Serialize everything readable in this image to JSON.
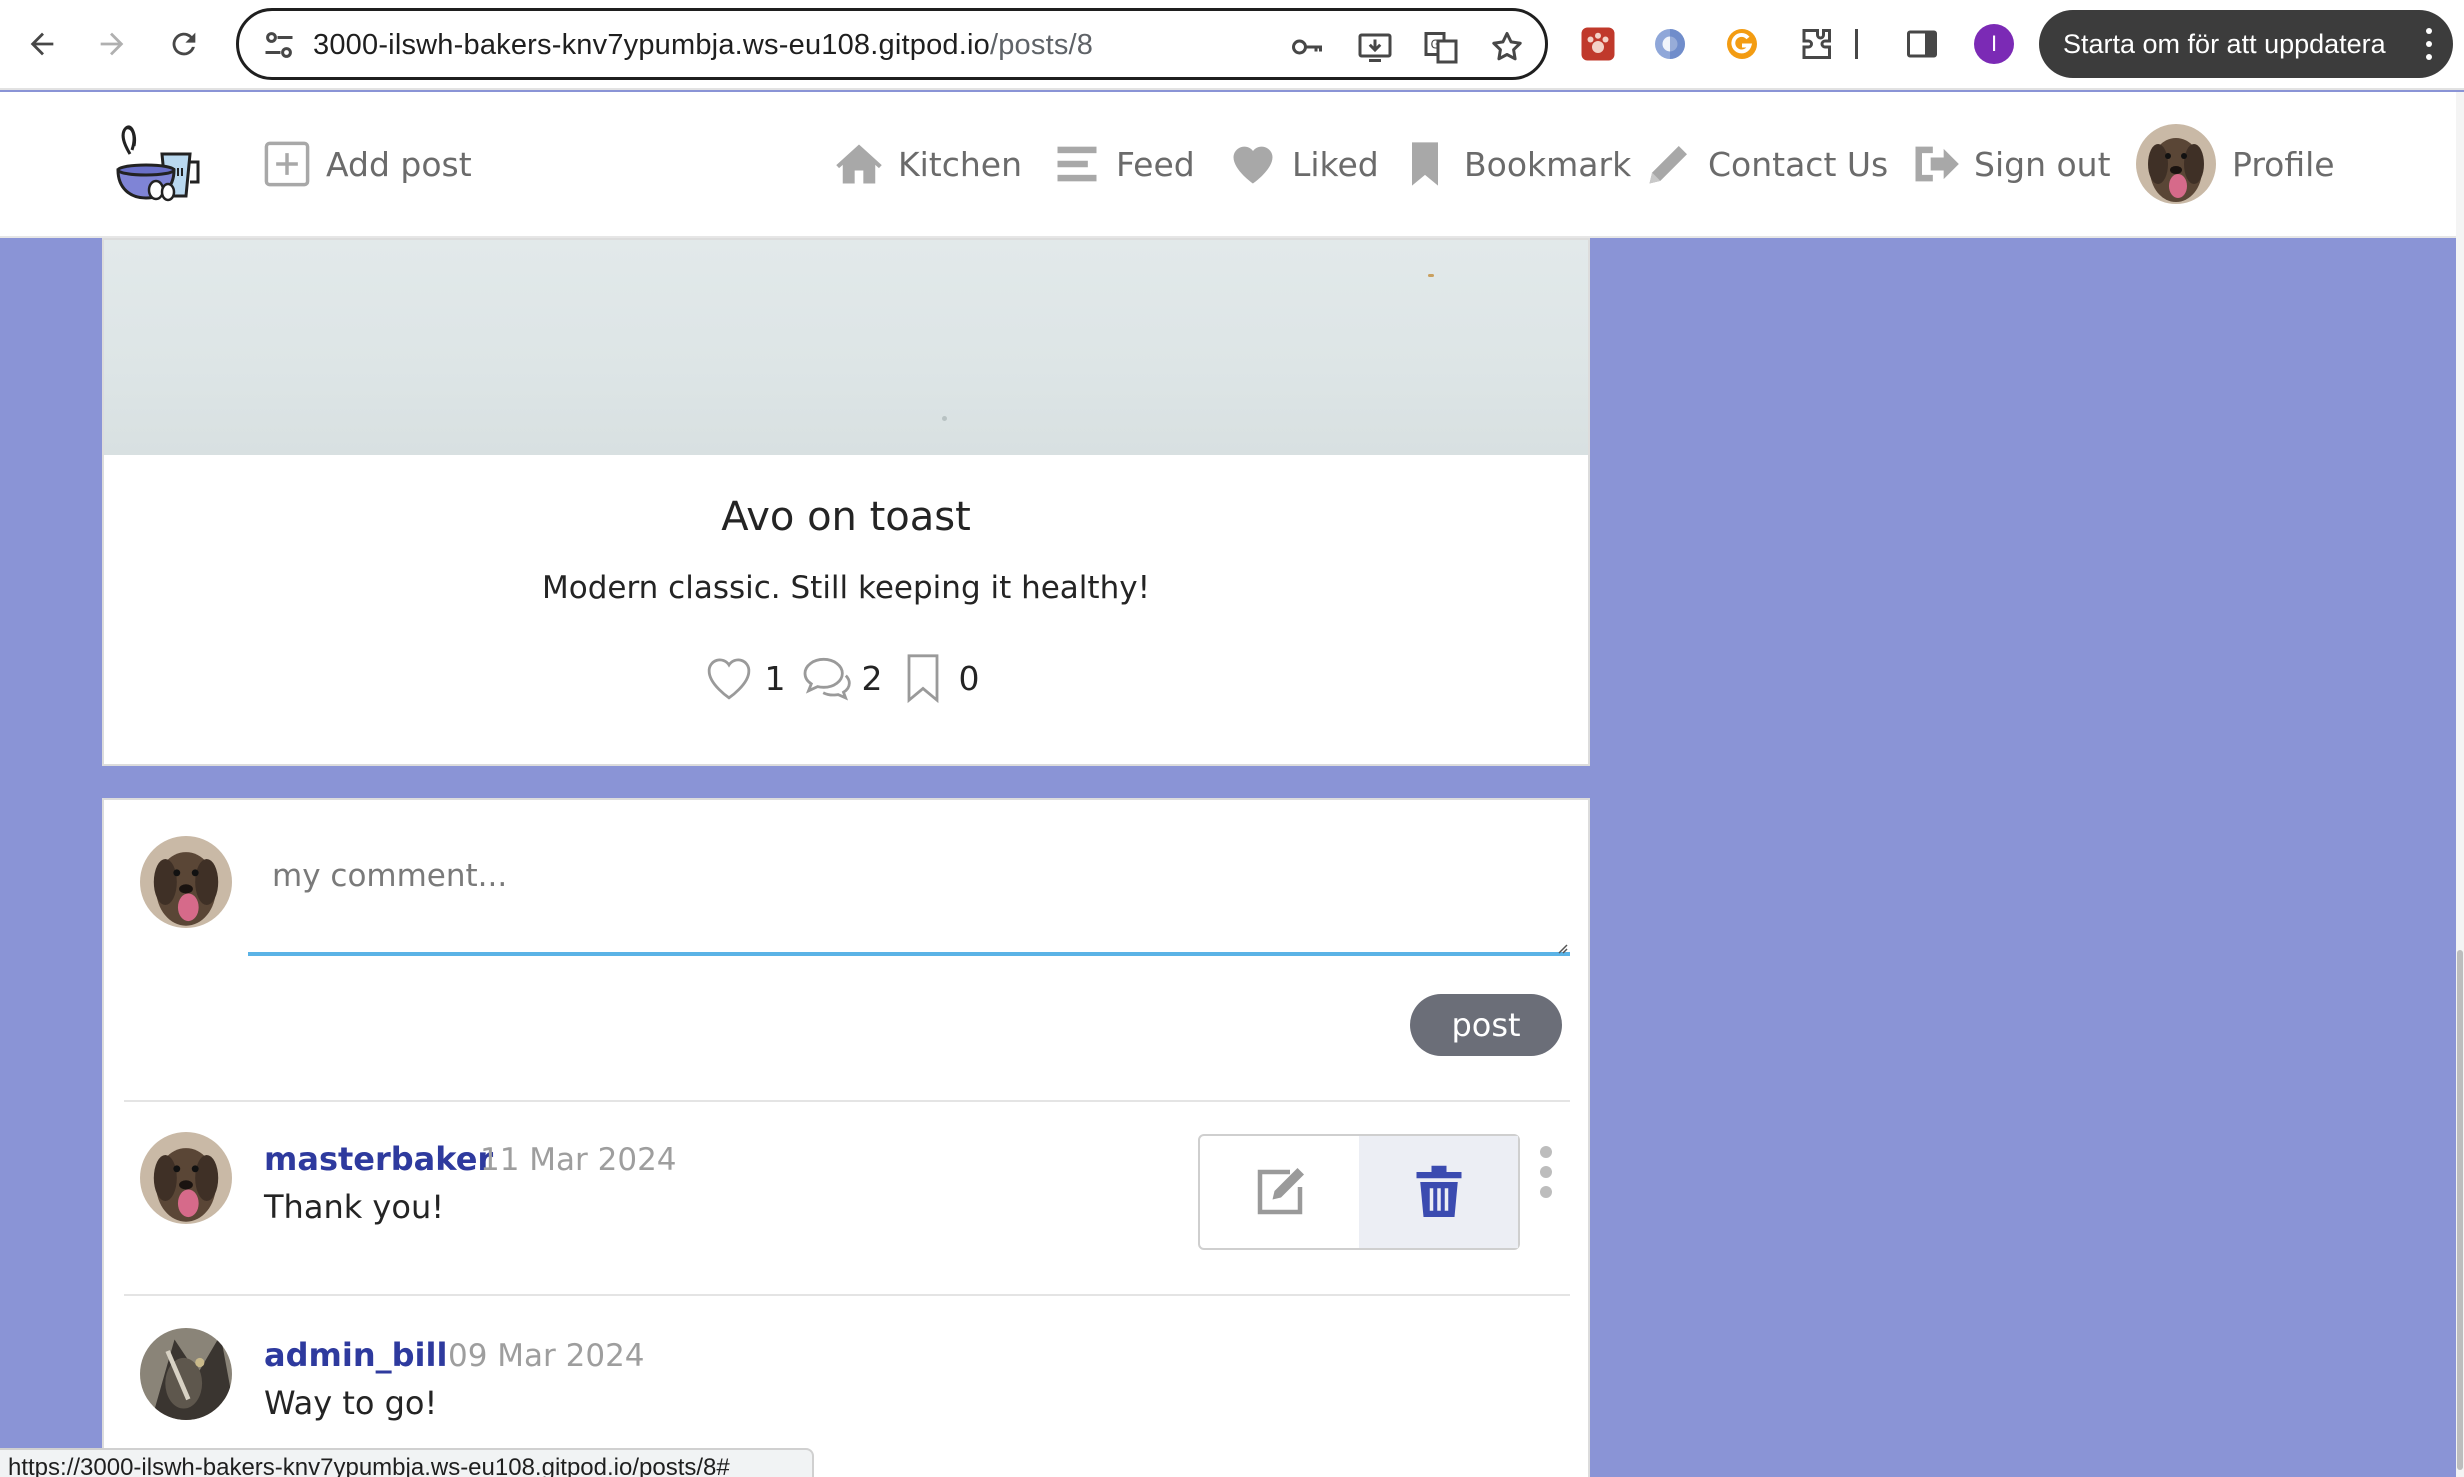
{
  "browser": {
    "url_host": "3000-ilswh-bakers-knv7ypumbja.ws-eu108.gitpod.io",
    "url_path": "/posts/8",
    "update_button_label": "Starta om för att uppdatera",
    "profile_initial": "I",
    "status_url": "https://3000-ilswh-bakers-knv7ypumbja.ws-eu108.gitpod.io/posts/8#"
  },
  "navbar": {
    "add_post": "Add post",
    "kitchen": "Kitchen",
    "feed": "Feed",
    "liked": "Liked",
    "bookmark": "Bookmark",
    "contact": "Contact Us",
    "sign_out": "Sign out",
    "profile": "Profile"
  },
  "post": {
    "title": "Avo on toast",
    "description": "Modern classic. Still keeping it healthy!",
    "likes": "1",
    "comments": "2",
    "bookmarks": "0"
  },
  "comment_form": {
    "placeholder": "my comment...",
    "submit_label": "post"
  },
  "comments": [
    {
      "author": "masterbaker",
      "date": "11 Mar 2024",
      "text": "Thank you!"
    },
    {
      "author": "admin_bill",
      "date": "09 Mar 2024",
      "text": "Way to go!"
    }
  ],
  "colors": {
    "page_background": "#8a94d6",
    "author_link": "#2e3a9e",
    "textarea_focus": "#5bb3e6",
    "delete_icon": "#3b4bb0"
  }
}
